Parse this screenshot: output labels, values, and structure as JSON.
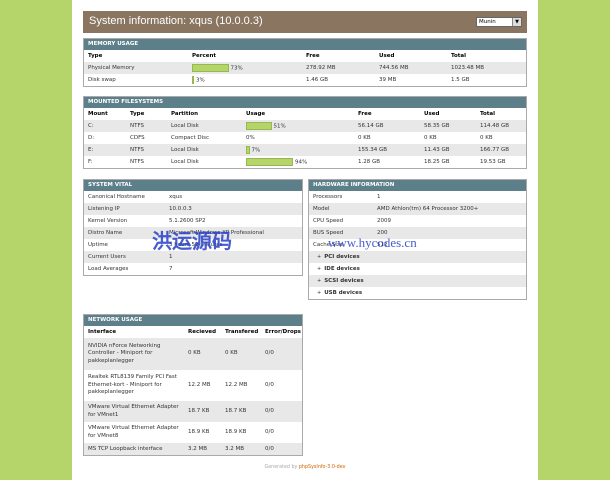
{
  "header": {
    "title": "System information: xqus (10.0.0.3)",
    "select_value": "Munin"
  },
  "memory": {
    "heading": "MEMORY USAGE",
    "columns": [
      "Type",
      "Percent",
      "Free",
      "Used",
      "Total"
    ],
    "rows": [
      {
        "type": "Physical Memory",
        "percent": 73,
        "percent_label": "73%",
        "free": "278.92 MB",
        "used": "744.56 MB",
        "total": "1023.48 MB"
      },
      {
        "type": "Disk swap",
        "percent": 3,
        "percent_label": "3%",
        "free": "1.46 GB",
        "used": "39 MB",
        "total": "1.5 GB"
      }
    ]
  },
  "filesystems": {
    "heading": "MOUNTED FILESYSTEMS",
    "columns": [
      "Mount",
      "Type",
      "Partition",
      "Usage",
      "Free",
      "Used",
      "Total"
    ],
    "rows": [
      {
        "mount": "C:",
        "type": "NTFS",
        "partition": "Local Disk",
        "usage": 51,
        "usage_label": "51%",
        "free": "56.14 GB",
        "used": "58.35 GB",
        "total": "114.48 GB"
      },
      {
        "mount": "D:",
        "type": "CDFS",
        "partition": "Compact Disc",
        "usage": 0,
        "usage_label": "0%",
        "free": "0 KB",
        "used": "0 KB",
        "total": "0 KB"
      },
      {
        "mount": "E:",
        "type": "NTFS",
        "partition": "Local Disk",
        "usage": 7,
        "usage_label": "7%",
        "free": "155.34 GB",
        "used": "11.43 GB",
        "total": "166.77 GB"
      },
      {
        "mount": "F:",
        "type": "NTFS",
        "partition": "Local Disk",
        "usage": 94,
        "usage_label": "94%",
        "free": "1.28 GB",
        "used": "18.25 GB",
        "total": "19.53 GB"
      }
    ]
  },
  "vital": {
    "heading": "SYSTEM VITAL",
    "rows": [
      {
        "label": "Canonical Hostname",
        "value": "xqus"
      },
      {
        "label": "Listening IP",
        "value": "10.0.0.3"
      },
      {
        "label": "Kernel Version",
        "value": "5.1.2600 SP2"
      },
      {
        "label": "Distro Name",
        "value": "Microsoft Windows XP Professional"
      },
      {
        "label": "Uptime",
        "value": "3 hours 59 minutes"
      },
      {
        "label": "Current Users",
        "value": "1"
      },
      {
        "label": "Load Averages",
        "value": "7"
      }
    ]
  },
  "hardware": {
    "heading": "HARDWARE INFORMATION",
    "rows": [
      {
        "label": "Processors",
        "value": "1"
      },
      {
        "label": "Model",
        "value": "AMD Athlon(tm) 64 Processor 3200+"
      },
      {
        "label": "CPU Speed",
        "value": "2009"
      },
      {
        "label": "BUS Speed",
        "value": "200"
      },
      {
        "label": "Cache Size",
        "value": "512"
      }
    ],
    "devices": [
      "PCI devices",
      "IDE devices",
      "SCSI devices",
      "USB devices"
    ],
    "expand_symbol": "+"
  },
  "network": {
    "heading": "NETWORK USAGE",
    "columns": [
      "Interface",
      "Recieved",
      "Transfered",
      "Error/Drops"
    ],
    "rows": [
      {
        "iface": "NVIDIA nForce Networking Controller - Miniport for pakkeplanlegger",
        "recv": "0 KB",
        "sent": "0 KB",
        "err": "0/0"
      },
      {
        "iface": "Realtek RTL8139 Family PCI Fast Ethernet-kort - Miniport for pakkeplanlegger",
        "recv": "12.2 MB",
        "sent": "12.2 MB",
        "err": "0/0"
      },
      {
        "iface": "VMware Virtual Ethernet Adapter for VMnet1",
        "recv": "18.7 KB",
        "sent": "18.7 KB",
        "err": "0/0"
      },
      {
        "iface": "VMware Virtual Ethernet Adapter for VMnet8",
        "recv": "18.9 KB",
        "sent": "18.9 KB",
        "err": "0/0"
      },
      {
        "iface": "MS TCP Loopback interface",
        "recv": "3.2 MB",
        "sent": "3.2 MB",
        "err": "0/0"
      }
    ]
  },
  "footer": {
    "prefix": "Generated by",
    "link": "phpSysInfo-3.0-dev"
  },
  "watermark": {
    "chinese": "洪运源码",
    "url": "www.hycodes.cn"
  }
}
